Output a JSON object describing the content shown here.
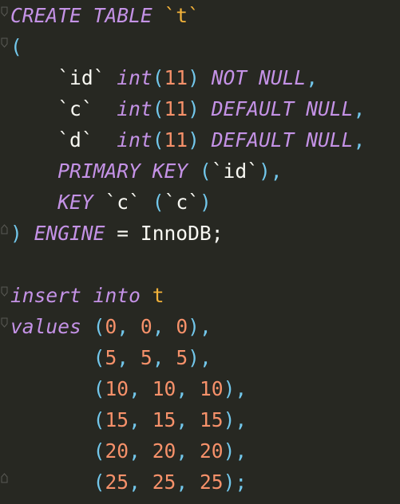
{
  "editor": {
    "background": "#272822",
    "colors": {
      "keyword": "#c492e6",
      "number": "#f6916a",
      "punctuation": "#72c7eb",
      "plain": "#f8f8f2",
      "identifier": "#f2b23a"
    },
    "lines": [
      [
        {
          "t": "CREATE TABLE ",
          "c": "kw"
        },
        {
          "t": "`t`",
          "c": "ident"
        }
      ],
      [
        {
          "t": "(",
          "c": "pun"
        }
      ],
      [
        {
          "t": "    `id` ",
          "c": "plain"
        },
        {
          "t": "int",
          "c": "kw"
        },
        {
          "t": "(",
          "c": "pun"
        },
        {
          "t": "11",
          "c": "num"
        },
        {
          "t": ")",
          "c": "pun"
        },
        {
          "t": " NOT NULL",
          "c": "kw"
        },
        {
          "t": ",",
          "c": "pun"
        }
      ],
      [
        {
          "t": "    `c`  ",
          "c": "plain"
        },
        {
          "t": "int",
          "c": "kw"
        },
        {
          "t": "(",
          "c": "pun"
        },
        {
          "t": "11",
          "c": "num"
        },
        {
          "t": ")",
          "c": "pun"
        },
        {
          "t": " DEFAULT NULL",
          "c": "kw"
        },
        {
          "t": ",",
          "c": "pun"
        }
      ],
      [
        {
          "t": "    `d`  ",
          "c": "plain"
        },
        {
          "t": "int",
          "c": "kw"
        },
        {
          "t": "(",
          "c": "pun"
        },
        {
          "t": "11",
          "c": "num"
        },
        {
          "t": ")",
          "c": "pun"
        },
        {
          "t": " DEFAULT NULL",
          "c": "kw"
        },
        {
          "t": ",",
          "c": "pun"
        }
      ],
      [
        {
          "t": "    ",
          "c": "plain"
        },
        {
          "t": "PRIMARY KEY",
          "c": "kw"
        },
        {
          "t": " ",
          "c": "plain"
        },
        {
          "t": "(",
          "c": "pun"
        },
        {
          "t": "`id`",
          "c": "plain"
        },
        {
          "t": "),",
          "c": "pun"
        }
      ],
      [
        {
          "t": "    ",
          "c": "plain"
        },
        {
          "t": "KEY",
          "c": "kw"
        },
        {
          "t": " `c` ",
          "c": "plain"
        },
        {
          "t": "(",
          "c": "pun"
        },
        {
          "t": "`c`",
          "c": "plain"
        },
        {
          "t": ")",
          "c": "pun"
        }
      ],
      [
        {
          "t": ")",
          "c": "pun"
        },
        {
          "t": " ENGINE",
          "c": "kw"
        },
        {
          "t": " = InnoDB;",
          "c": "plain"
        }
      ],
      [
        {
          "t": "",
          "c": "plain"
        }
      ],
      [
        {
          "t": "insert into",
          "c": "kw"
        },
        {
          "t": " ",
          "c": "plain"
        },
        {
          "t": "t",
          "c": "ident"
        }
      ],
      [
        {
          "t": "values",
          "c": "kw"
        },
        {
          "t": " ",
          "c": "plain"
        },
        {
          "t": "(",
          "c": "pun"
        },
        {
          "t": "0",
          "c": "num"
        },
        {
          "t": ", ",
          "c": "pun"
        },
        {
          "t": "0",
          "c": "num"
        },
        {
          "t": ", ",
          "c": "pun"
        },
        {
          "t": "0",
          "c": "num"
        },
        {
          "t": "),",
          "c": "pun"
        }
      ],
      [
        {
          "t": "       ",
          "c": "plain"
        },
        {
          "t": "(",
          "c": "pun"
        },
        {
          "t": "5",
          "c": "num"
        },
        {
          "t": ", ",
          "c": "pun"
        },
        {
          "t": "5",
          "c": "num"
        },
        {
          "t": ", ",
          "c": "pun"
        },
        {
          "t": "5",
          "c": "num"
        },
        {
          "t": "),",
          "c": "pun"
        }
      ],
      [
        {
          "t": "       ",
          "c": "plain"
        },
        {
          "t": "(",
          "c": "pun"
        },
        {
          "t": "10",
          "c": "num"
        },
        {
          "t": ", ",
          "c": "pun"
        },
        {
          "t": "10",
          "c": "num"
        },
        {
          "t": ", ",
          "c": "pun"
        },
        {
          "t": "10",
          "c": "num"
        },
        {
          "t": "),",
          "c": "pun"
        }
      ],
      [
        {
          "t": "       ",
          "c": "plain"
        },
        {
          "t": "(",
          "c": "pun"
        },
        {
          "t": "15",
          "c": "num"
        },
        {
          "t": ", ",
          "c": "pun"
        },
        {
          "t": "15",
          "c": "num"
        },
        {
          "t": ", ",
          "c": "pun"
        },
        {
          "t": "15",
          "c": "num"
        },
        {
          "t": "),",
          "c": "pun"
        }
      ],
      [
        {
          "t": "       ",
          "c": "plain"
        },
        {
          "t": "(",
          "c": "pun"
        },
        {
          "t": "20",
          "c": "num"
        },
        {
          "t": ", ",
          "c": "pun"
        },
        {
          "t": "20",
          "c": "num"
        },
        {
          "t": ", ",
          "c": "pun"
        },
        {
          "t": "20",
          "c": "num"
        },
        {
          "t": "),",
          "c": "pun"
        }
      ],
      [
        {
          "t": "       ",
          "c": "plain"
        },
        {
          "t": "(",
          "c": "pun"
        },
        {
          "t": "25",
          "c": "num"
        },
        {
          "t": ", ",
          "c": "pun"
        },
        {
          "t": "25",
          "c": "num"
        },
        {
          "t": ", ",
          "c": "pun"
        },
        {
          "t": "25",
          "c": "num"
        },
        {
          "t": ");",
          "c": "pun"
        }
      ]
    ]
  }
}
